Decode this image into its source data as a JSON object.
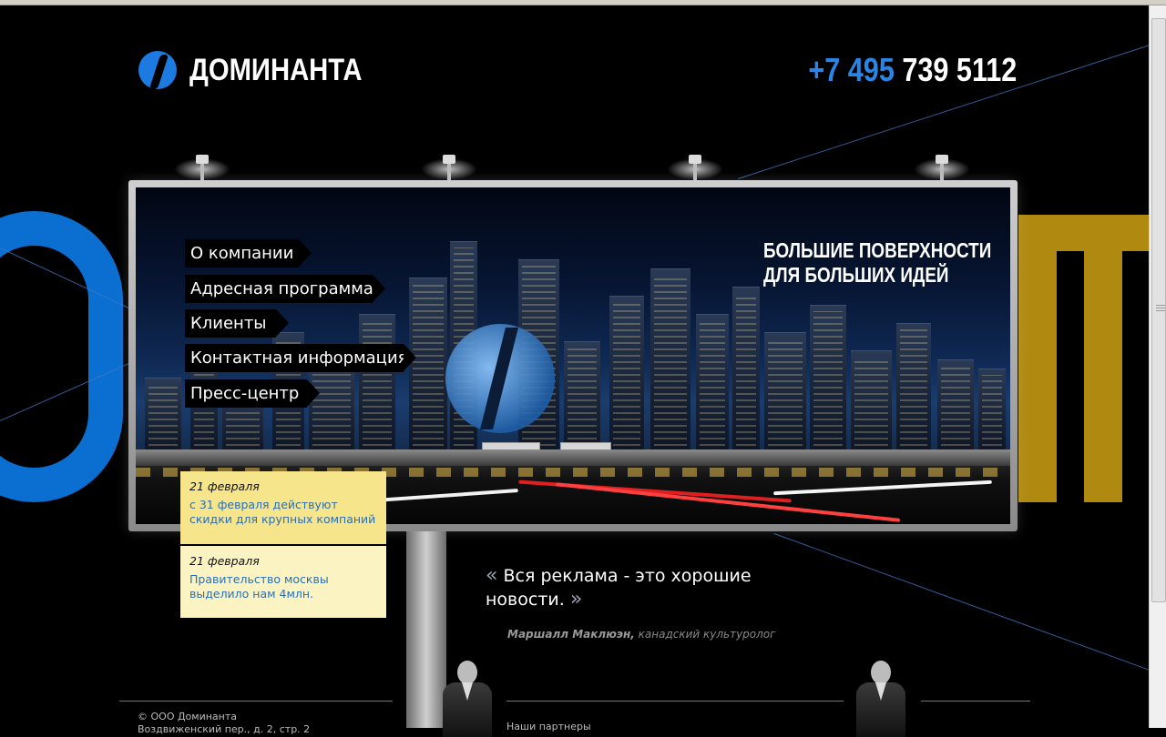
{
  "header": {
    "logo_text": "ДОМИНАНТА",
    "phone_code": "+7 495",
    "phone_number": "739 5112"
  },
  "billboard": {
    "tagline": "БОЛЬШИЕ ПОВЕРХНОСТИ\nДЛЯ БОЛЬШИХ ИДЕЙ"
  },
  "menu": {
    "items": [
      {
        "label": "О компании"
      },
      {
        "label": "Адресная программа"
      },
      {
        "label": "Клиенты"
      },
      {
        "label": "Контактная информация"
      },
      {
        "label": "Пресс-центр"
      }
    ]
  },
  "news": [
    {
      "date": "21 февраля",
      "text": "с 31 февраля действуют скидки для крупных компаний"
    },
    {
      "date": "21 февраля",
      "text": "Правительство москвы выделило нам 4млн."
    }
  ],
  "quote": {
    "open_mark": "«",
    "text": "Вся реклама - это хорошие новости.",
    "close_mark": "»",
    "author": "Маршалл Маклюэн,",
    "author_role": " канадский культуролог"
  },
  "footer": {
    "copyright": "© ООО Доминанта",
    "address_partial": "Воздвиженский пер., д. 2, стр. 2",
    "partners_label": "Наши партнеры"
  },
  "colors": {
    "accent_blue": "#2a86e6",
    "news_yellow": "#f6e58a",
    "news_light": "#fbf4c2",
    "bg_gold": "#b08a10"
  }
}
